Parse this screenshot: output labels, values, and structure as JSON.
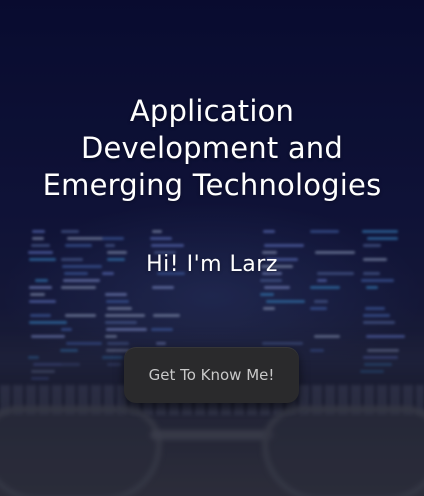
{
  "hero": {
    "headline": "Application Development and Emerging Technologies",
    "greeting": "Hi! I'm Larz",
    "cta_label": "Get To Know Me!"
  },
  "colors": {
    "background": "#0c0f2e",
    "text": "#ffffff",
    "button_bg": "#2a2a2c",
    "button_text": "#c9c9c9"
  }
}
